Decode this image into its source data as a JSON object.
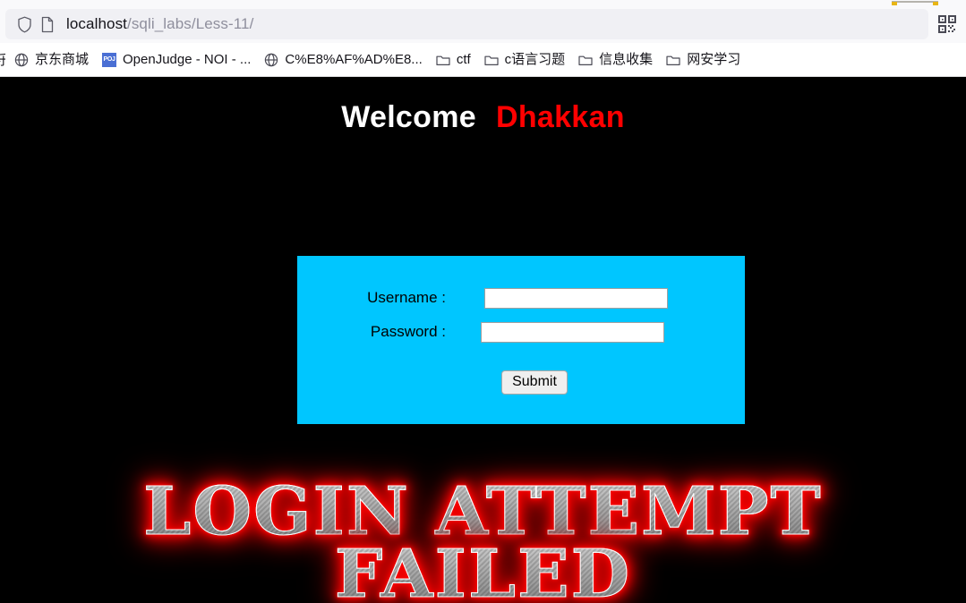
{
  "browser": {
    "urlbar": {
      "shield_icon": "shield-icon",
      "page_icon": "page-icon",
      "url_host": "localhost",
      "url_path": "/sqli_labs/Less-11/",
      "qr_icon": "qr-code-icon"
    },
    "bookmarks": {
      "clipped_left_text": "乐",
      "items": [
        {
          "icon": "globe-icon",
          "label": "京东商城"
        },
        {
          "icon": "poj-favicon-icon",
          "label": "OpenJudge - NOI - ..."
        },
        {
          "icon": "globe-icon",
          "label": "C%E8%AF%AD%E8..."
        },
        {
          "icon": "folder-icon",
          "label": "ctf"
        },
        {
          "icon": "folder-icon",
          "label": "c语言习题"
        },
        {
          "icon": "folder-icon",
          "label": "信息收集"
        },
        {
          "icon": "folder-icon",
          "label": "网安学习"
        }
      ]
    }
  },
  "page": {
    "heading": {
      "welcome": "Welcome",
      "name": "Dhakkan"
    },
    "login_form": {
      "username_label": "Username :",
      "password_label": "Password :",
      "username_value": "",
      "password_value": "",
      "username_placeholder": "",
      "password_placeholder": "",
      "submit_label": "Submit",
      "panel_color": "#00c6ff"
    },
    "result_banner": {
      "line1": "LOGIN ATTEMPT",
      "line2": "FAILED",
      "glow_color": "#ff0000",
      "text_color": "#c9c9c9"
    },
    "background_color": "#000000"
  }
}
